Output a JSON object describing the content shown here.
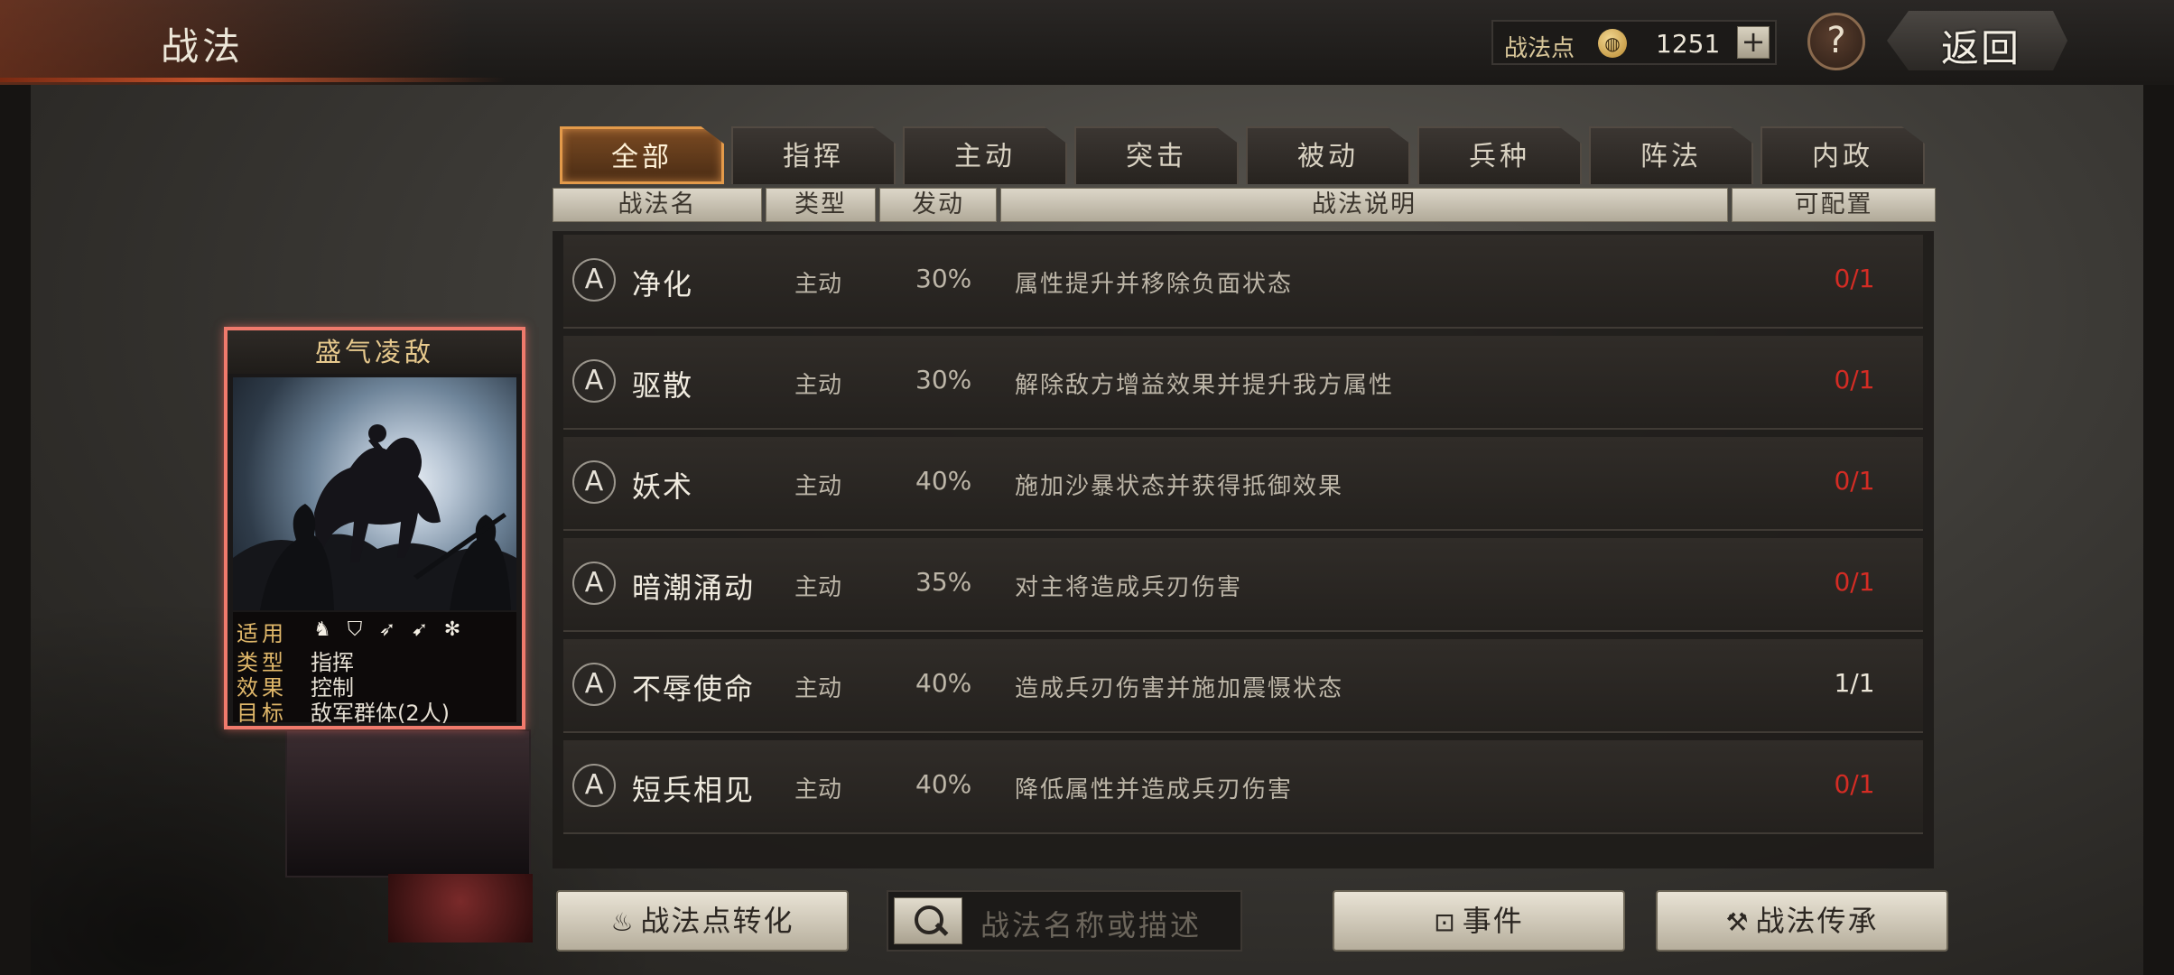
{
  "header": {
    "title": "战法",
    "points_label": "战法点",
    "points_value": "1251",
    "plus": "+",
    "help": "?",
    "back_label": "返回"
  },
  "tabs": [
    "全部",
    "指挥",
    "主动",
    "突击",
    "被动",
    "兵种",
    "阵法",
    "内政"
  ],
  "active_tab": "全部",
  "columns": [
    "战法名",
    "类型",
    "发动",
    "战法说明",
    "可配置"
  ],
  "rows": [
    {
      "badge": "A",
      "name": "净化",
      "type": "主动",
      "rate": "30%",
      "desc": "属性提升并移除负面状态",
      "cfg": "0/1",
      "cfg_color": "#d42c24"
    },
    {
      "badge": "A",
      "name": "驱散",
      "type": "主动",
      "rate": "30%",
      "desc": "解除敌方增益效果并提升我方属性",
      "cfg": "0/1",
      "cfg_color": "#d42c24"
    },
    {
      "badge": "A",
      "name": "妖术",
      "type": "主动",
      "rate": "40%",
      "desc": "施加沙暴状态并获得抵御效果",
      "cfg": "0/1",
      "cfg_color": "#d42c24"
    },
    {
      "badge": "A",
      "name": "暗潮涌动",
      "type": "主动",
      "rate": "35%",
      "desc": "对主将造成兵刃伤害",
      "cfg": "0/1",
      "cfg_color": "#d42c24"
    },
    {
      "badge": "A",
      "name": "不辱使命",
      "type": "主动",
      "rate": "40%",
      "desc": "造成兵刃伤害并施加震慑状态",
      "cfg": "1/1",
      "cfg_color": "#ece6d8"
    },
    {
      "badge": "A",
      "name": "短兵相见",
      "type": "主动",
      "rate": "40%",
      "desc": "降低属性并造成兵刃伤害",
      "cfg": "0/1",
      "cfg_color": "#d42c24"
    }
  ],
  "card": {
    "title": "盛气凌敌",
    "apply_label": "适用",
    "apply_icons": [
      "cavalry-icon",
      "shield-icon",
      "bow-icon",
      "spear-icon",
      "chariot-icon"
    ],
    "type_label": "类型",
    "type_value": "指挥",
    "effect_label": "效果",
    "effect_value": "控制",
    "target_label": "目标",
    "target_value": "敌军群体(2人)"
  },
  "buttons": {
    "convert": "战法点转化",
    "event": "事件",
    "inherit": "战法传承"
  },
  "search": {
    "placeholder": "战法名称或描述"
  }
}
